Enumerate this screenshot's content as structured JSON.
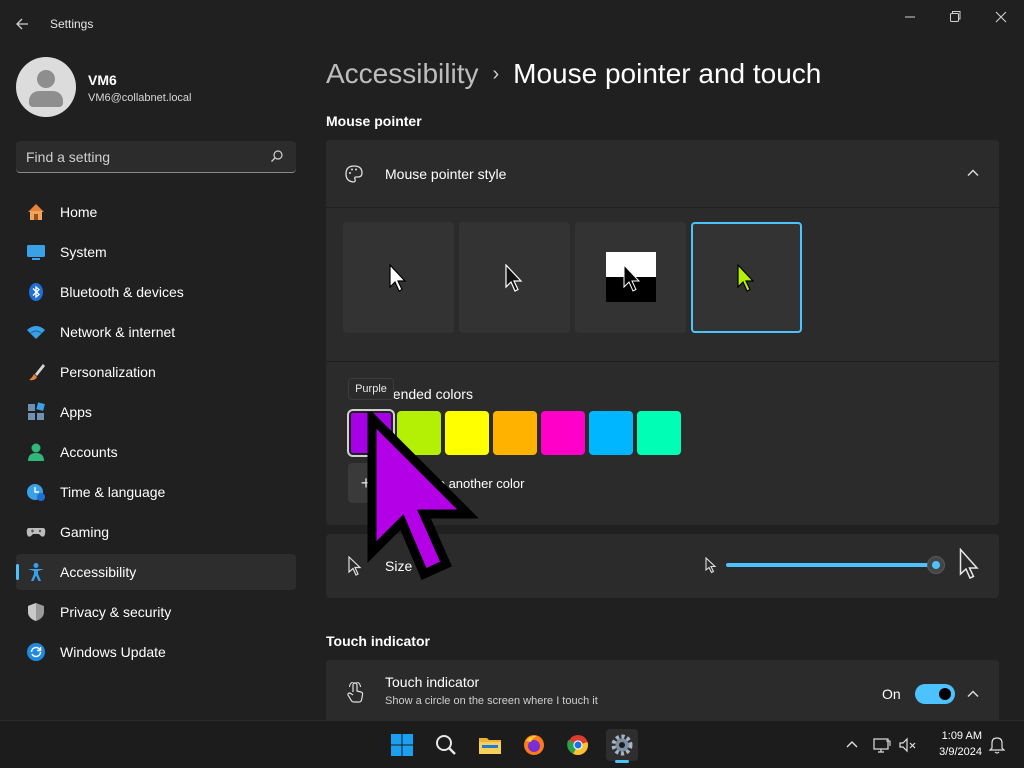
{
  "window": {
    "app_title": "Settings"
  },
  "user": {
    "name": "VM6",
    "email": "VM6@collabnet.local"
  },
  "search": {
    "placeholder": "Find a setting"
  },
  "sidebar": {
    "items": [
      {
        "label": "Home",
        "icon": "home-icon"
      },
      {
        "label": "System",
        "icon": "system-icon"
      },
      {
        "label": "Bluetooth & devices",
        "icon": "bluetooth-icon"
      },
      {
        "label": "Network & internet",
        "icon": "wifi-icon"
      },
      {
        "label": "Personalization",
        "icon": "brush-icon"
      },
      {
        "label": "Apps",
        "icon": "apps-icon"
      },
      {
        "label": "Accounts",
        "icon": "accounts-icon"
      },
      {
        "label": "Time & language",
        "icon": "globe-icon"
      },
      {
        "label": "Gaming",
        "icon": "gamepad-icon"
      },
      {
        "label": "Accessibility",
        "icon": "accessibility-icon",
        "active": true
      },
      {
        "label": "Privacy & security",
        "icon": "shield-icon"
      },
      {
        "label": "Windows Update",
        "icon": "update-icon"
      }
    ]
  },
  "breadcrumb": {
    "parent": "Accessibility",
    "separator": "›",
    "current": "Mouse pointer and touch"
  },
  "mouse_pointer": {
    "section_title": "Mouse pointer",
    "style_label": "Mouse pointer style",
    "styles": [
      "white",
      "black",
      "inverted",
      "custom"
    ],
    "selected_style": "custom",
    "recommended_label": "nended colors",
    "tooltip": "Purple",
    "colors": [
      {
        "name": "Purple",
        "hex": "#a500e6",
        "selected": true
      },
      {
        "name": "Lime",
        "hex": "#b4ef06"
      },
      {
        "name": "Yellow",
        "hex": "#ffff00"
      },
      {
        "name": "Gold",
        "hex": "#ffb300"
      },
      {
        "name": "Pink",
        "hex": "#ff00c8"
      },
      {
        "name": "Turquoise",
        "hex": "#00b7ff"
      },
      {
        "name": "Green",
        "hex": "#00ffb4"
      }
    ],
    "custom_button": "+",
    "custom_label": "ose another color",
    "size_label": "Size",
    "size_value": 0.99
  },
  "touch": {
    "section_title": "Touch indicator",
    "label": "Touch indicator",
    "description": "Show a circle on the screen where I touch it",
    "state_label": "On",
    "enabled": true
  },
  "taskbar": {
    "time": "1:09 AM",
    "date": "3/9/2024",
    "apps": [
      "start-icon",
      "search-icon",
      "file-explorer-icon",
      "firefox-icon",
      "chrome-icon",
      "settings-icon"
    ]
  },
  "colors": {
    "accent": "#4cc2ff",
    "background": "#202020",
    "card": "#2b2b2b"
  }
}
